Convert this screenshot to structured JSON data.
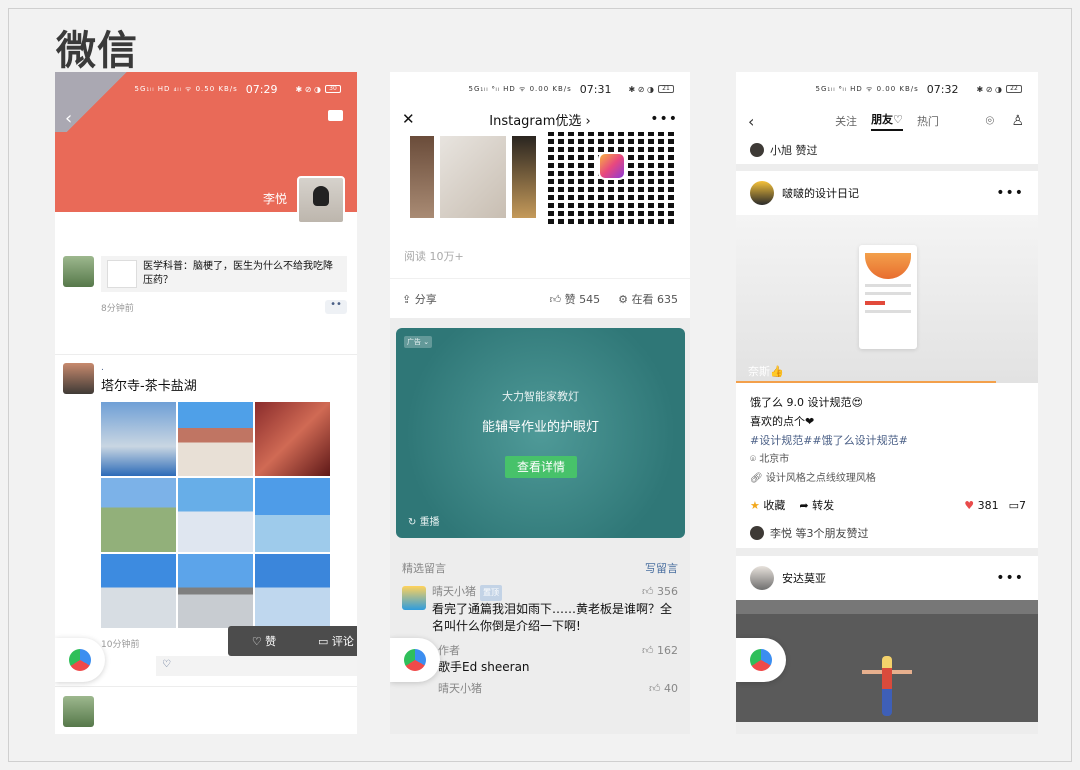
{
  "title": "微信",
  "phone1": {
    "status": {
      "signal": "5G₁ₗₗ HD ₄ₗₗ ᯤ 0.50 KB/s",
      "time": "07:29",
      "right": "✱ ⊘ ◑",
      "battery": "30"
    },
    "username": "李悦",
    "post1": {
      "share_text": "医学科普：脑梗了，医生为什么不给我吃降压药？",
      "time": "8分钟前",
      "dots": "••"
    },
    "post2": {
      "name": ".",
      "text": "塔尔寺-茶卡盐湖",
      "time": "10分钟前",
      "dots": "••"
    },
    "popup": {
      "like": "♡ 赞",
      "comment": "▭ 评论"
    },
    "like_icon": "♡"
  },
  "phone2": {
    "status": {
      "signal": "5G₁ₗₗ ⁶ₗₗ HD ᯤ 0.00 KB/s",
      "time": "07:31",
      "right": "✱ ⊘ ◑",
      "battery": "21"
    },
    "nav_title": "Instagram优选 ›",
    "reads": "阅读 10万+",
    "share": "分享",
    "likes": "赞 545",
    "watching": "在看 635",
    "ad": {
      "tag": "广告 ⌄",
      "brand": "大力智能家教灯",
      "slogan": "能辅导作业的护眼灯",
      "cta": "查看详情",
      "replay": "重播"
    },
    "comments_label": "精选留言",
    "write_comment": "写留言",
    "comments": [
      {
        "name": "晴天小猪",
        "badge": "置顶",
        "likes": "356",
        "text": "看完了通篇我泪如雨下……黄老板是谁啊？全名叫什么你倒是介绍一下啊!"
      },
      {
        "name": "作者",
        "likes": "162",
        "text": "歌手Ed sheeran"
      },
      {
        "name": "晴天小猪",
        "likes": "40"
      }
    ]
  },
  "phone3": {
    "status": {
      "signal": "5G₁ₗₗ ⁶ₗₗ HD ᯤ 0.00 KB/s",
      "time": "07:32",
      "right": "✱ ⊘ ◑",
      "battery": "22"
    },
    "tabs": [
      "关注",
      "朋友♡",
      "热门"
    ],
    "liked_by": "小旭 赞过",
    "card1": {
      "author": "啵啵的设计日记",
      "caption": "奈斯👍",
      "line1": "饿了么 9.0 设计规范😍",
      "line2": "喜欢的点个❤",
      "tags": "#设计规范##饿了么设计规范#",
      "location": "北京市",
      "link": "设计风格之点线纹理风格",
      "fav": "收藏",
      "forward": "转发",
      "like_count": "381",
      "comment_count": "7",
      "friends_liked": "李悦 等3个朋友赞过"
    },
    "card2": {
      "author": "安达莫亚"
    }
  }
}
